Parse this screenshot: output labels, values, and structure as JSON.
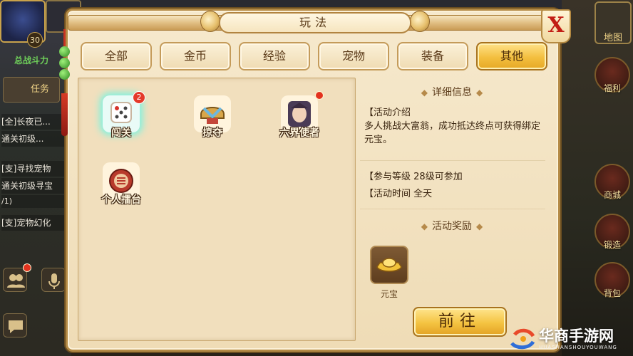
{
  "background": {
    "player_level": "30",
    "power_label": "总战斗力",
    "task_label": "任务",
    "chat_lines": [
      "[全]长夜已...",
      "通关初级...",
      "[支]寻找宠物",
      "通关初级寻宝",
      "/1)",
      "[支]宠物幻化"
    ],
    "map_label": "地图",
    "right_buttons": [
      "福利",
      "商城",
      "锻造",
      "背包"
    ]
  },
  "dialog": {
    "title": "玩法",
    "close_label": "X",
    "tabs": [
      {
        "label": "全部",
        "active": false
      },
      {
        "label": "金币",
        "active": false
      },
      {
        "label": "经验",
        "active": false
      },
      {
        "label": "宠物",
        "active": false
      },
      {
        "label": "装备",
        "active": false
      },
      {
        "label": "其他",
        "active": true
      }
    ],
    "activities": [
      {
        "label": "闯关",
        "icon": "dice-icon",
        "badge": "2",
        "selected": true
      },
      {
        "label": "掠夺",
        "icon": "helmet-icon",
        "badge": null,
        "selected": false
      },
      {
        "label": "六界使者",
        "icon": "warrior-portrait-icon",
        "badge": "dot",
        "selected": false
      },
      {
        "label": "个人擂台",
        "icon": "drum-icon",
        "badge": null,
        "selected": false
      }
    ],
    "detail": {
      "info_title": "详细信息",
      "intro_label": "【活动介绍",
      "intro_text": "多人挑战大富翁，成功抵达终点可获得绑定元宝。",
      "level_label": "【参与等级",
      "level_value": "28级可参加",
      "time_label": "【活动时间",
      "time_value": "全天",
      "reward_title": "活动奖励",
      "reward_item": "元宝",
      "go_button": "前往"
    }
  },
  "watermark": {
    "text": "华商手游网",
    "subtext": "HUASHANSHOUYOUWANG"
  }
}
